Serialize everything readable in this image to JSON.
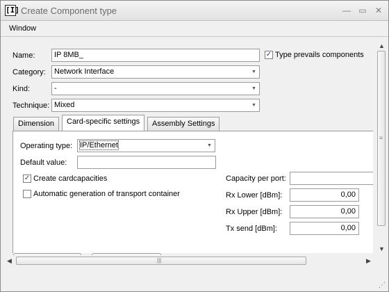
{
  "window": {
    "title": "Create Component type",
    "app_icon_glyph": "[I]",
    "minimize_glyph": "—",
    "maximize_glyph": "▭",
    "close_glyph": "✕"
  },
  "menu": {
    "window_label": "Window"
  },
  "form": {
    "name_label": "Name:",
    "name_value": "IP 8MB_",
    "type_prevails_label": "Type prevails components",
    "type_prevails_checked": true,
    "category_label": "Category:",
    "category_value": "Network Interface",
    "kind_label": "Kind:",
    "kind_value": "-",
    "technique_label": "Technique:",
    "technique_value": "Mixed"
  },
  "tabs": [
    {
      "label": "Dimension",
      "active": false
    },
    {
      "label": "Card-specific settings",
      "active": true
    },
    {
      "label": "Assembly Settings",
      "active": false
    }
  ],
  "card_settings": {
    "operating_type_label": "Operating type:",
    "operating_type_value": "IP/Ethernet",
    "default_value_label": "Default value:",
    "default_value_value": "",
    "create_cardcapacities_label": "Create cardcapacities",
    "create_cardcapacities_checked": true,
    "auto_transport_label": "Automatic generation of transport container",
    "auto_transport_checked": false,
    "capacity_per_port_label": "Capacity per port:",
    "capacity_per_port_value": "",
    "rx_lower_label": "Rx Lower [dBm]:",
    "rx_lower_value": "0,00",
    "rx_upper_label": "Rx Upper [dBm]:",
    "rx_upper_value": "0,00",
    "tx_send_label": "Tx send [dBm]:",
    "tx_send_value": "0,00"
  },
  "glyphs": {
    "check": "✓",
    "dropdown": "▼",
    "arrow_up": "▲",
    "arrow_down": "▼",
    "arrow_left": "◀",
    "arrow_right": "▶",
    "grip_h": "|||",
    "grip_v": "≡",
    "resize_grip": "⋰"
  }
}
